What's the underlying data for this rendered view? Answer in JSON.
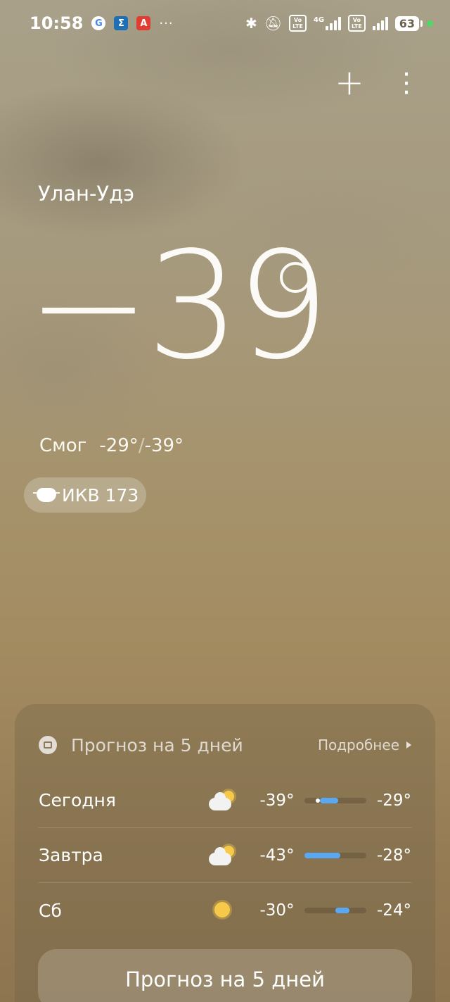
{
  "status_bar": {
    "time": "10:58",
    "app_icons": [
      "G",
      "Σ",
      "А"
    ],
    "overflow": "···",
    "battery": "63",
    "network": "4G",
    "volte_label_1": "Vo\nLTE",
    "volte_label_2": "Vo\nLTE"
  },
  "toolbar": {
    "add_icon": "+",
    "more_icon": "⋮"
  },
  "current": {
    "city": "Улан-Удэ",
    "temperature": "−39",
    "condition": "Смог",
    "high": "-29°",
    "low": "-39°",
    "separator": "/",
    "aqi": "ИКВ 173"
  },
  "forecast": {
    "title": "Прогноз на 5 дней",
    "more_link": "Подробнее",
    "days": [
      {
        "day": "Сегодня",
        "icon": "partly-cloudy-icon",
        "low": "-39°",
        "high": "-29°",
        "fill_start": 0.25,
        "fill_end": 0.55,
        "current_marker": 0.22
      },
      {
        "day": "Завтра",
        "icon": "partly-cloudy-icon",
        "low": "-43°",
        "high": "-28°",
        "fill_start": 0.0,
        "fill_end": 0.58
      },
      {
        "day": "Сб",
        "icon": "sunny-icon",
        "low": "-30°",
        "high": "-24°",
        "fill_start": 0.5,
        "fill_end": 0.73
      }
    ],
    "button_label": "Прогноз на 5 дней"
  },
  "colors": {
    "accent_bar": "#5aa8f2",
    "sun": "#f7c948"
  }
}
